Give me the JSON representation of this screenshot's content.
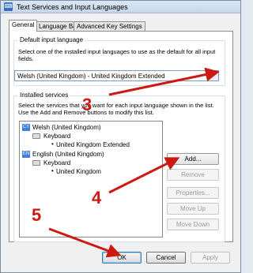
{
  "window": {
    "title": "Text Services and Input Languages"
  },
  "tabs": [
    {
      "label": "General"
    },
    {
      "label": "Language Bar"
    },
    {
      "label": "Advanced Key Settings"
    }
  ],
  "default_input": {
    "group_label": "Default input language",
    "description": "Select one of the installed input languages to use as the default for all input fields.",
    "selected_value": "Welsh (United Kingdom) - United Kingdom Extended"
  },
  "installed_services": {
    "group_label": "Installed services",
    "description": "Select the services that you want for each input language shown in the list. Use the Add and Remove buttons to modify this list.",
    "languages": [
      {
        "badge": "CY",
        "name": "Welsh (United Kingdom)",
        "category": "Keyboard",
        "layout": "United Kingdom Extended"
      },
      {
        "badge": "EN",
        "name": "English (United Kingdom)",
        "category": "Keyboard",
        "layout": "United Kingdom"
      }
    ],
    "buttons": {
      "add": "Add...",
      "remove": "Remove",
      "properties": "Properties...",
      "move_up": "Move Up",
      "move_down": "Move Down"
    }
  },
  "footer": {
    "ok": "OK",
    "cancel": "Cancel",
    "apply": "Apply"
  },
  "annotations": {
    "step3": "3",
    "step4": "4",
    "step5": "5",
    "color": "#cc1a12"
  }
}
